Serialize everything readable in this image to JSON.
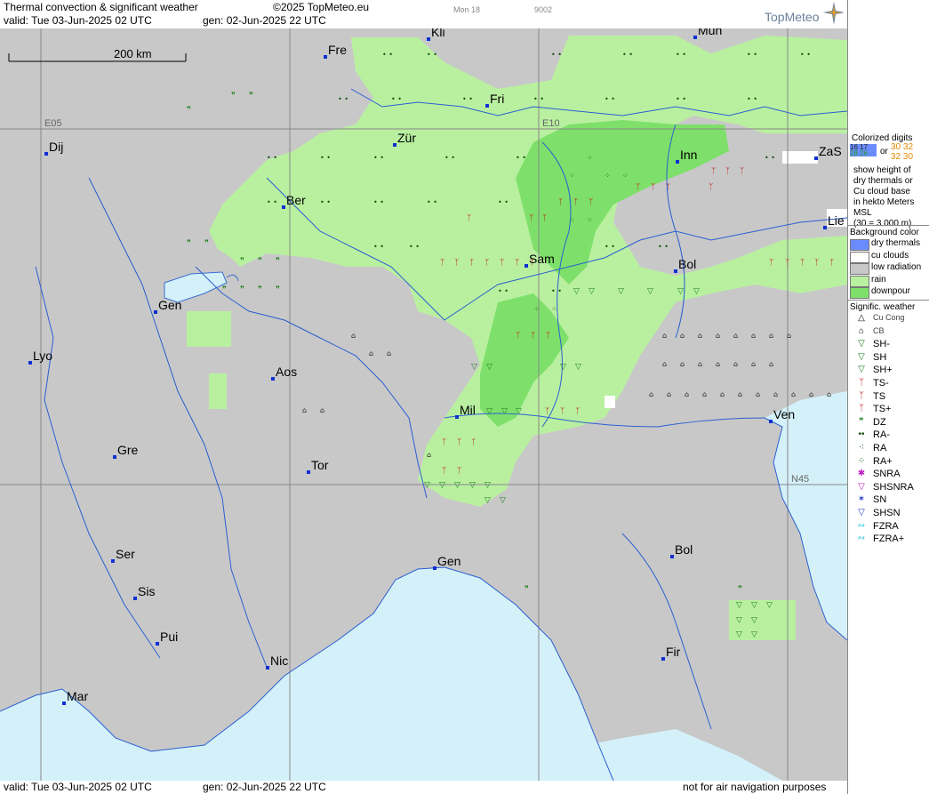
{
  "header": {
    "title": "Thermal convection & significant weather",
    "copyright": "©2025 TopMeteo.eu",
    "valid": "valid:  Tue  03-Jun-2025  02 UTC",
    "gen": "gen: 02-Jun-2025 22 UTC",
    "weekday": "Mon 18",
    "code": "9002",
    "logo": "TopMeteo"
  },
  "map": {
    "scale_label": "200 km",
    "grid_labels": {
      "e05": "E05",
      "e10": "E10",
      "n45": "N45"
    },
    "cities": [
      {
        "name": "Kli"
      },
      {
        "name": "Mün"
      },
      {
        "name": "Fre"
      },
      {
        "name": "Fri"
      },
      {
        "name": "Dij"
      },
      {
        "name": "Zür"
      },
      {
        "name": "Inn"
      },
      {
        "name": "ZaS"
      },
      {
        "name": "Ber"
      },
      {
        "name": "Lie"
      },
      {
        "name": "Sam"
      },
      {
        "name": "Bol"
      },
      {
        "name": "Gen"
      },
      {
        "name": "Lyo"
      },
      {
        "name": "Aos"
      },
      {
        "name": "Mil"
      },
      {
        "name": "Ven"
      },
      {
        "name": "Gre"
      },
      {
        "name": "Tor"
      },
      {
        "name": "Ser"
      },
      {
        "name": "Gen"
      },
      {
        "name": "Bol"
      },
      {
        "name": "Sis"
      },
      {
        "name": "Pui"
      },
      {
        "name": "Nic"
      },
      {
        "name": "Fir"
      },
      {
        "name": "Mar"
      }
    ]
  },
  "footer": {
    "valid": "valid:  Tue  03-Jun-2025  02 UTC",
    "gen": "gen: 02-Jun-2025 22 UTC",
    "note": "not for air navigation purposes"
  },
  "legend": {
    "colorized_title": "Colorized digits",
    "digits_a": "16 17",
    "digits_b": "30 32",
    "or_label": "or",
    "digits_c": "28 26",
    "digits_d": "32 30",
    "desc": [
      "show height of",
      "dry thermals or",
      "Cu cloud base",
      "in hekto Meters",
      "MSL",
      "(30 = 3.000 m)"
    ],
    "bg_title": "Background color",
    "bg_items": [
      {
        "label": "dry thermals",
        "color": "#6b8cff"
      },
      {
        "label": "cu clouds",
        "color": "#ffffff"
      },
      {
        "label": "low radiation",
        "color": "#c8c8c8"
      },
      {
        "label": "rain",
        "color": "#b9f0a0"
      },
      {
        "label": "downpour",
        "color": "#7ee06a"
      }
    ],
    "wx_title": "Signific. weather",
    "wx_items": [
      {
        "label": "Cu Cong",
        "glyph": "△"
      },
      {
        "label": "CB",
        "glyph": "⌂"
      },
      {
        "label": "SH-",
        "glyph": "▽"
      },
      {
        "label": "SH",
        "glyph": "▽"
      },
      {
        "label": "SH+",
        "glyph": "▽"
      },
      {
        "label": "TS-",
        "glyph": "ᛉ"
      },
      {
        "label": "TS",
        "glyph": "ᛉ"
      },
      {
        "label": "TS+",
        "glyph": "ᛉ"
      },
      {
        "label": "DZ",
        "glyph": "❞"
      },
      {
        "label": "RA-",
        "glyph": "••"
      },
      {
        "label": "RA",
        "glyph": "⁖"
      },
      {
        "label": "RA+",
        "glyph": "⁘"
      },
      {
        "label": "SNRA",
        "glyph": "✱"
      },
      {
        "label": "SHSNRA",
        "glyph": "▽"
      },
      {
        "label": "SN",
        "glyph": "✶"
      },
      {
        "label": "SHSN",
        "glyph": "▽"
      },
      {
        "label": "FZRA",
        "glyph": "∾"
      },
      {
        "label": "FZRA+",
        "glyph": "∾"
      }
    ]
  }
}
